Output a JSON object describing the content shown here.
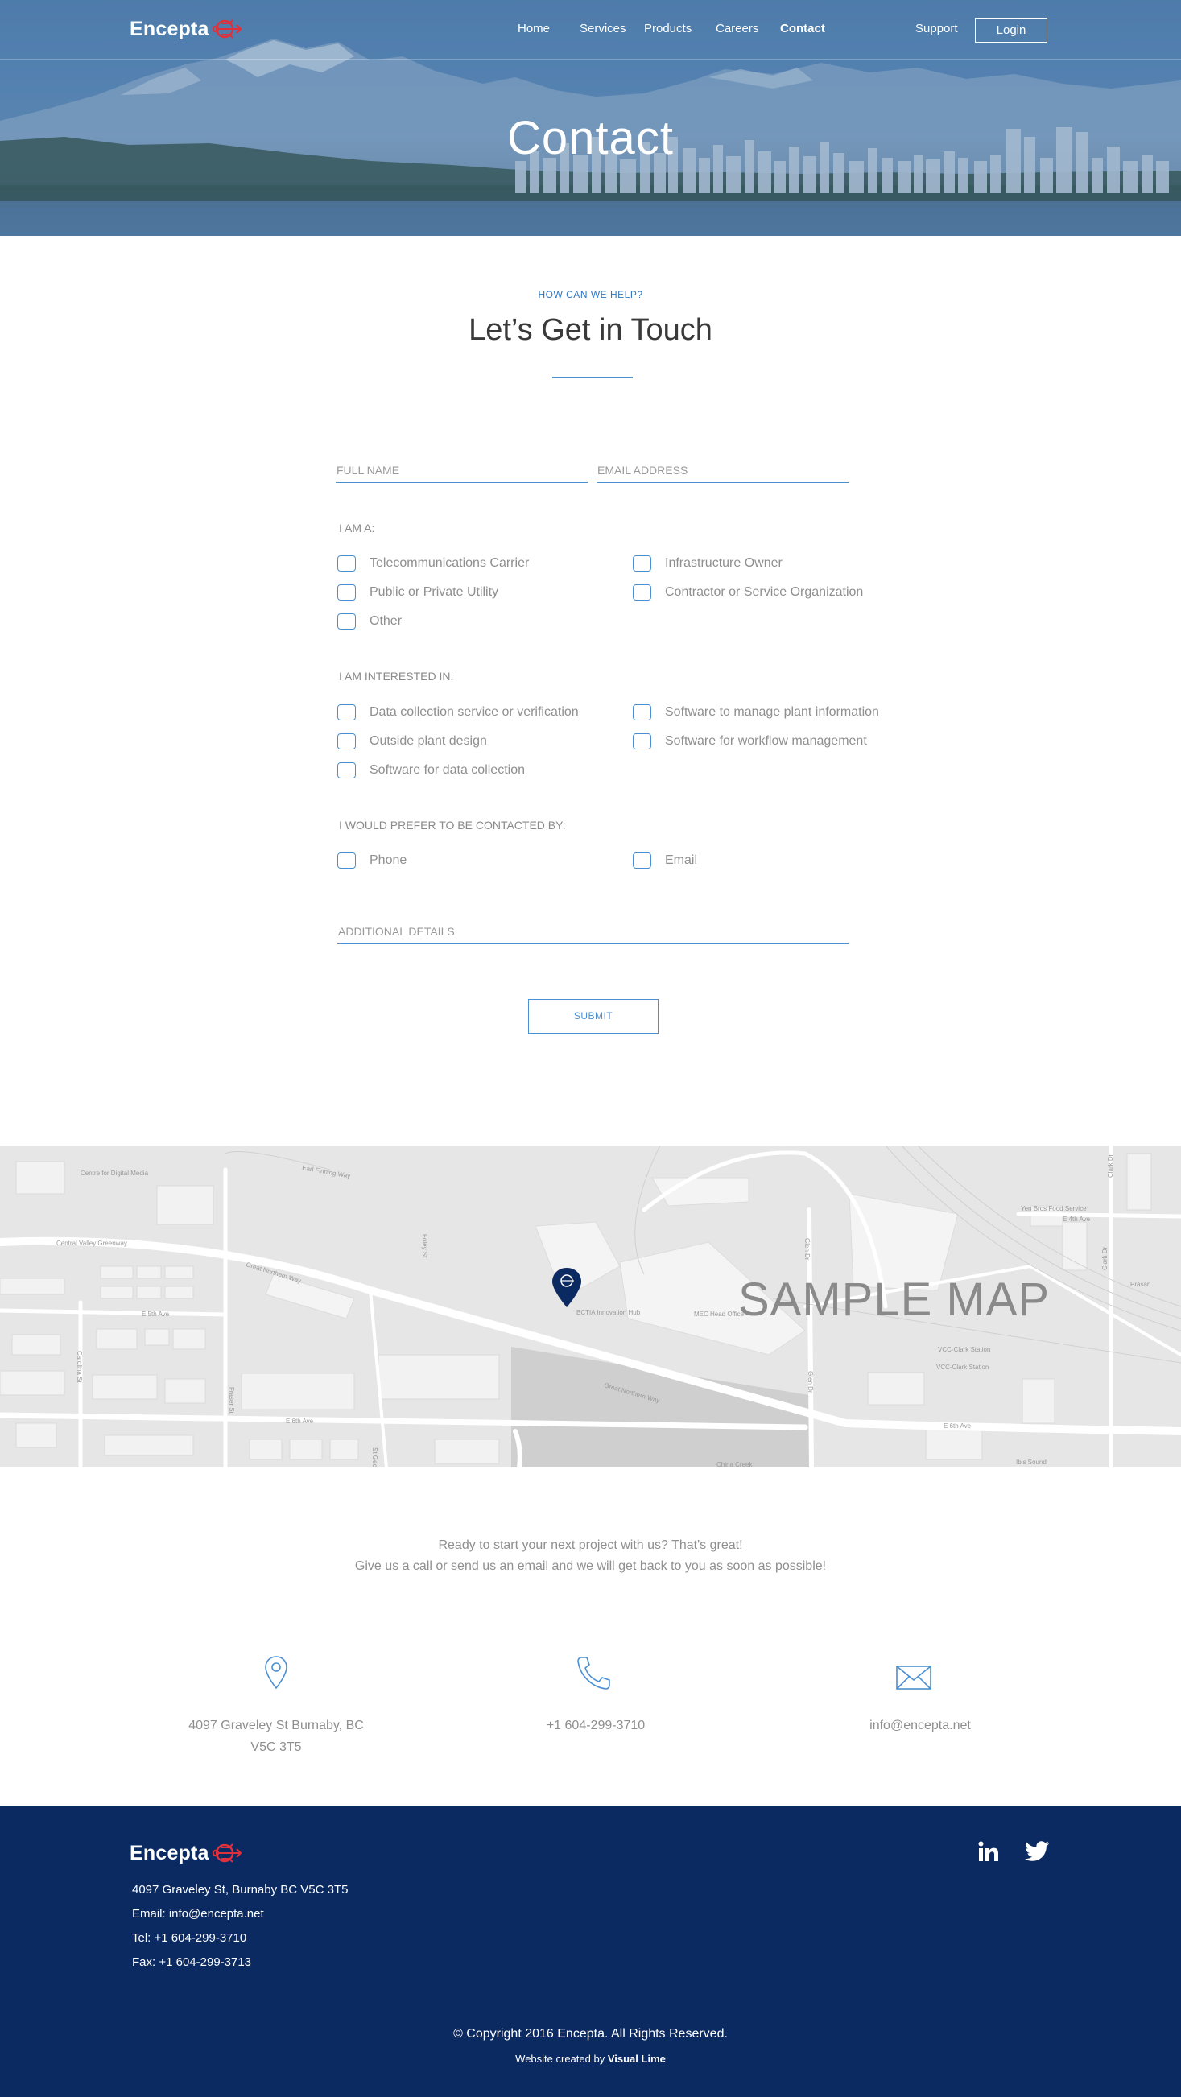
{
  "brand": {
    "name": "Encepta",
    "accent": "#e0303c"
  },
  "nav": {
    "items": [
      "Home",
      "Services",
      "Products",
      "Careers",
      "Contact"
    ],
    "active": "Contact",
    "support": "Support",
    "login": "Login"
  },
  "hero": {
    "title": "Contact"
  },
  "form_section": {
    "eyebrow": "HOW CAN WE HELP?",
    "title": "Let’s Get in Touch",
    "full_name_placeholder": "FULL NAME",
    "email_placeholder": "EMAIL ADDRESS",
    "groups": [
      {
        "label": "I AM A:",
        "options": [
          "Telecommunications Carrier",
          "Infrastructure Owner",
          "Public or Private Utility",
          "Contractor or Service Organization",
          "Other"
        ]
      },
      {
        "label": "I AM INTERESTED IN:",
        "options": [
          "Data collection service or verification",
          "Software to manage plant information",
          "Outside plant design",
          "Software for workflow management",
          "Software for data collection"
        ]
      },
      {
        "label": "I WOULD PREFER TO BE CONTACTED BY:",
        "options": [
          "Phone",
          "Email"
        ]
      }
    ],
    "details_placeholder": "ADDITIONAL DETAILS",
    "submit": "SUBMIT"
  },
  "map": {
    "label": "SAMPLE MAP",
    "streets": [
      "Great Northern Way",
      "Great Northern Way",
      "Central Valley Greenway",
      "E 6th Ave",
      "E 6th Ave",
      "E 5th Ave",
      "E 4th Ave",
      "Glen Dr",
      "Glen Dr",
      "Clark Dr",
      "Clark Dr",
      "Fraser St",
      "Carolina St",
      "Foley St",
      "St George",
      "Earl Finning Way",
      "China Creek"
    ],
    "places": [
      "Centre for Digital Media",
      "BCTIA Innovation Hub",
      "MEC Head Office",
      "VCC-Clark Station",
      "VCC-Clark Station",
      "Yen Bros Food Service",
      "Prasan",
      "Ibis Sound"
    ]
  },
  "cta": {
    "line1": "Ready to start your next project with us? That's great!",
    "line2": "Give us a call or send us an email and we will get back to you as soon as possible!"
  },
  "contact": {
    "address_line1": "4097 Graveley St Burnaby, BC",
    "address_line2": "V5C 3T5",
    "phone": "+1 604-299-3710",
    "email": "info@encepta.net"
  },
  "footer": {
    "address": "4097 Graveley St, Burnaby BC V5C 3T5",
    "email": "Email: info@encepta.net",
    "tel": "Tel: +1 604-299-3710",
    "fax": "Fax: +1 604-299-3713",
    "copyright": "© Copyright 2016 Encepta. All Rights Reserved.",
    "credit_prefix": "Website created by",
    "credit_name": "Visual Lime",
    "social": [
      "linkedin-icon",
      "twitter-icon"
    ]
  },
  "colors": {
    "link_blue": "#4a8fd1",
    "footer_navy": "#0c2a62",
    "title_dark": "#3a3a3a"
  }
}
